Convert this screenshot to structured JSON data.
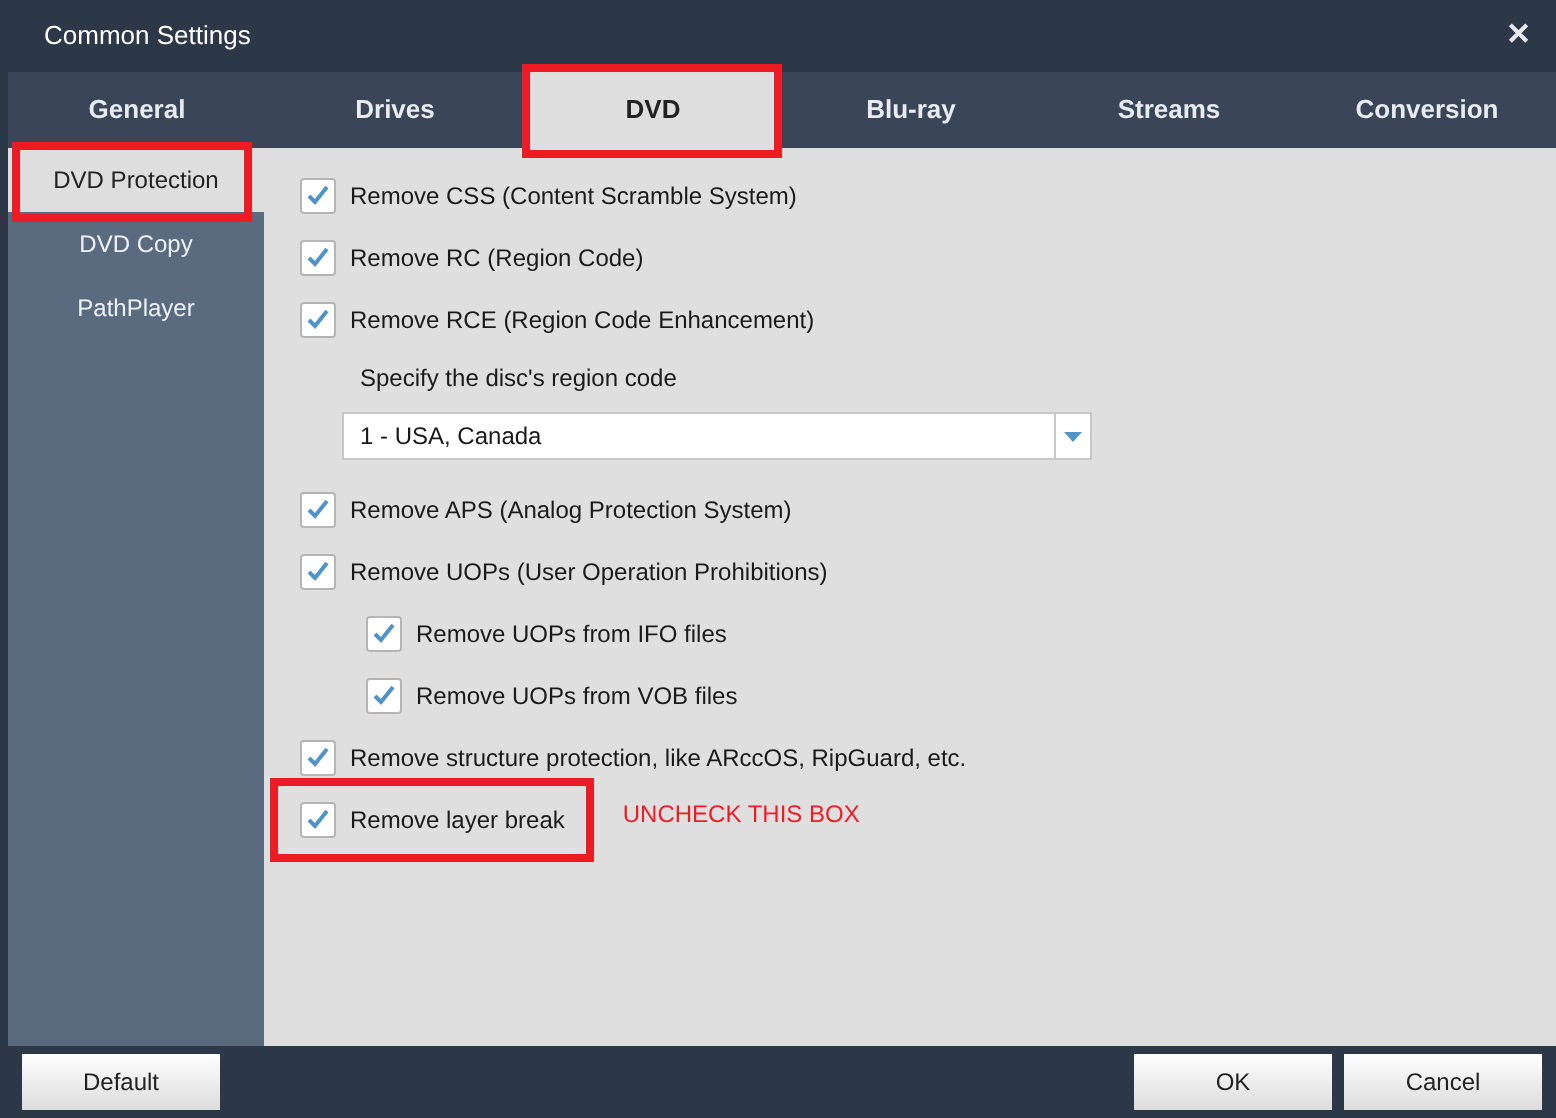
{
  "window": {
    "title": "Common Settings",
    "close": "✕"
  },
  "tabs": [
    {
      "label": "General",
      "selected": false,
      "highlighted": false
    },
    {
      "label": "Drives",
      "selected": false,
      "highlighted": false
    },
    {
      "label": "DVD",
      "selected": true,
      "highlighted": true
    },
    {
      "label": "Blu-ray",
      "selected": false,
      "highlighted": false
    },
    {
      "label": "Streams",
      "selected": false,
      "highlighted": false
    },
    {
      "label": "Conversion",
      "selected": false,
      "highlighted": false
    }
  ],
  "sidebar": {
    "items": [
      {
        "label": "DVD Protection",
        "selected": true,
        "highlighted": true
      },
      {
        "label": "DVD Copy",
        "selected": false,
        "highlighted": false
      },
      {
        "label": "PathPlayer",
        "selected": false,
        "highlighted": false
      }
    ]
  },
  "options": [
    {
      "kind": "checkbox",
      "label": "Remove CSS (Content Scramble System)",
      "checked": true
    },
    {
      "kind": "checkbox",
      "label": "Remove RC (Region Code)",
      "checked": true
    },
    {
      "kind": "checkbox",
      "label": "Remove RCE (Region Code Enhancement)",
      "checked": true
    },
    {
      "kind": "label",
      "label": "Specify the disc's region code"
    },
    {
      "kind": "dropdown",
      "value": "1 - USA, Canada"
    },
    {
      "kind": "checkbox",
      "label": "Remove APS (Analog Protection System)",
      "checked": true
    },
    {
      "kind": "checkbox",
      "label": "Remove UOPs (User Operation Prohibitions)",
      "checked": true,
      "children": [
        {
          "kind": "checkbox",
          "label": "Remove UOPs from IFO files",
          "checked": true
        },
        {
          "kind": "checkbox",
          "label": "Remove UOPs from VOB files",
          "checked": true
        }
      ]
    },
    {
      "kind": "checkbox",
      "label": "Remove structure protection, like ARccOS, RipGuard, etc.",
      "checked": true
    },
    {
      "kind": "checkbox",
      "label": "Remove layer break",
      "checked": true,
      "highlighted": true,
      "note": "UNCHECK THIS BOX"
    }
  ],
  "buttons": [
    {
      "label": "Default"
    },
    {
      "label": "OK"
    },
    {
      "label": "Cancel"
    }
  ]
}
